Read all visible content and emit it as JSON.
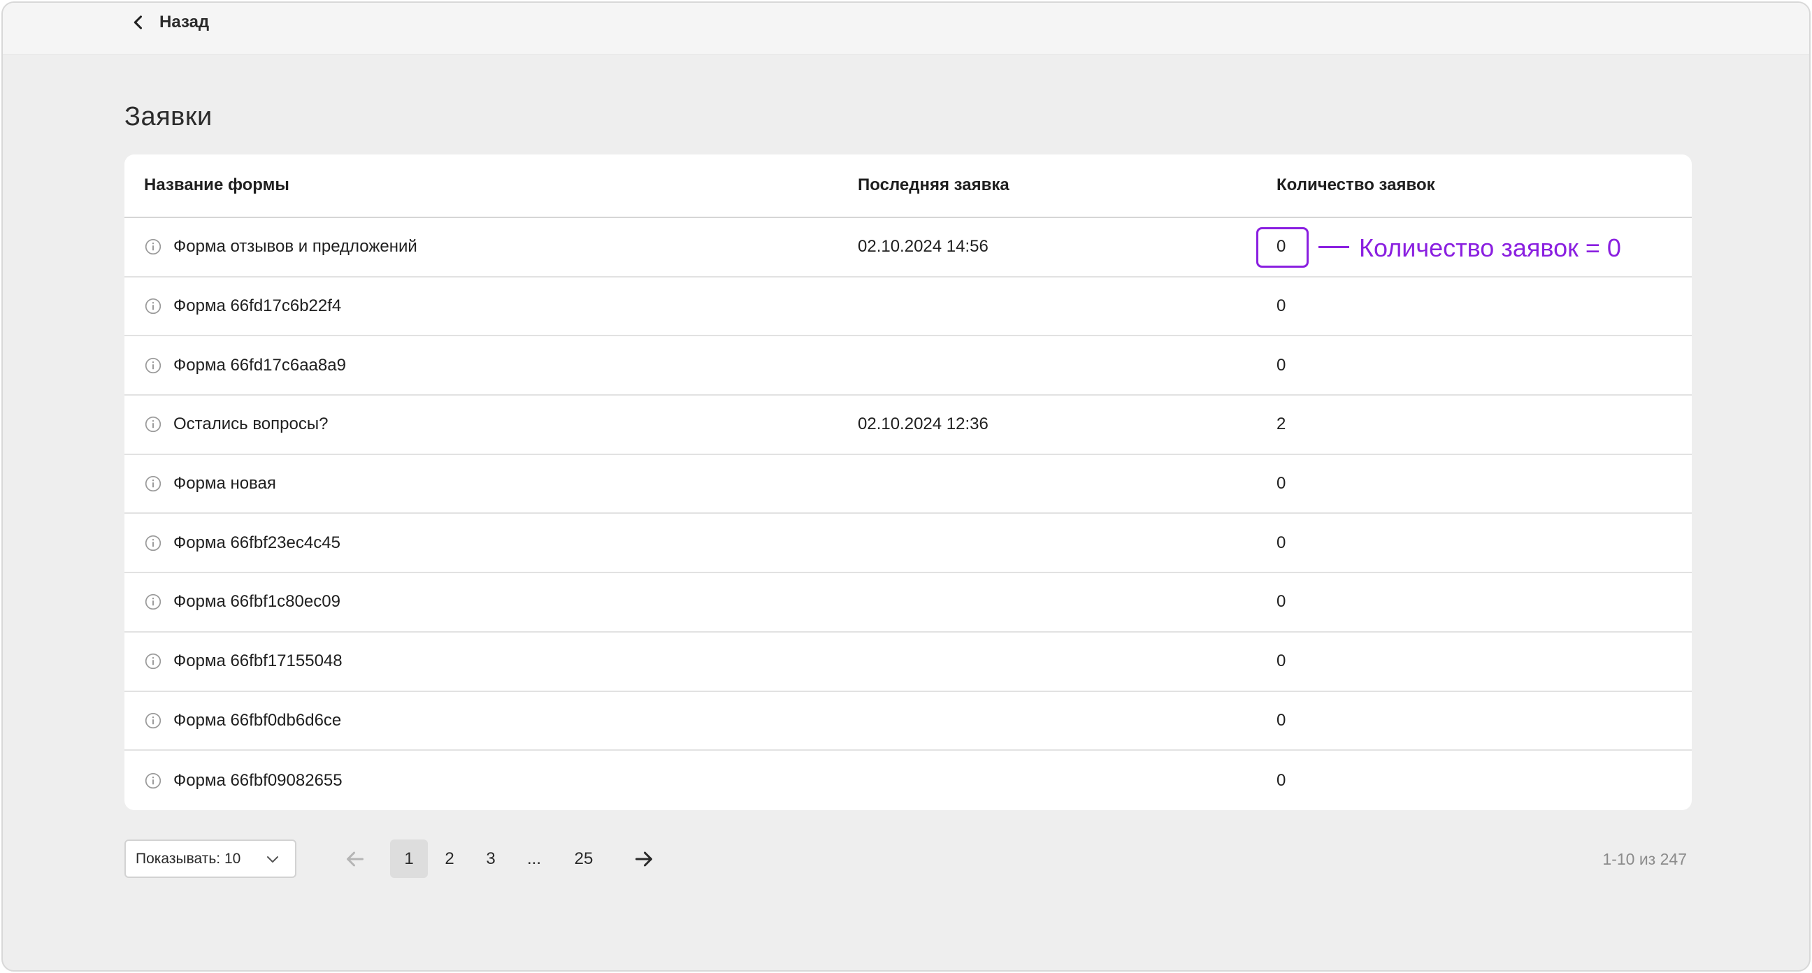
{
  "header": {
    "back_label": "Назад"
  },
  "page": {
    "title": "Заявки"
  },
  "table": {
    "columns": [
      "Название формы",
      "Последняя заявка",
      "Количество заявок"
    ],
    "rows": [
      {
        "name": "Форма отзывов и предложений",
        "last": "02.10.2024 14:56",
        "count": "0"
      },
      {
        "name": "Форма 66fd17c6b22f4",
        "last": "",
        "count": "0"
      },
      {
        "name": "Форма 66fd17c6aa8a9",
        "last": "",
        "count": "0"
      },
      {
        "name": "Остались вопросы?",
        "last": "02.10.2024 12:36",
        "count": "2"
      },
      {
        "name": "Форма новая",
        "last": "",
        "count": "0"
      },
      {
        "name": "Форма 66fbf23ec4c45",
        "last": "",
        "count": "0"
      },
      {
        "name": "Форма 66fbf1c80ec09",
        "last": "",
        "count": "0"
      },
      {
        "name": "Форма 66fbf17155048",
        "last": "",
        "count": "0"
      },
      {
        "name": "Форма 66fbf0db6d6ce",
        "last": "",
        "count": "0"
      },
      {
        "name": "Форма 66fbf09082655",
        "last": "",
        "count": "0"
      }
    ]
  },
  "annotation": {
    "text": "Количество заявок = 0",
    "color": "#8a1fe0"
  },
  "pagination": {
    "per_page_label": "Показывать: 10",
    "pages": [
      "1",
      "2",
      "3",
      "...",
      "25"
    ],
    "active_page": "1",
    "range_text": "1-10 из 247"
  }
}
